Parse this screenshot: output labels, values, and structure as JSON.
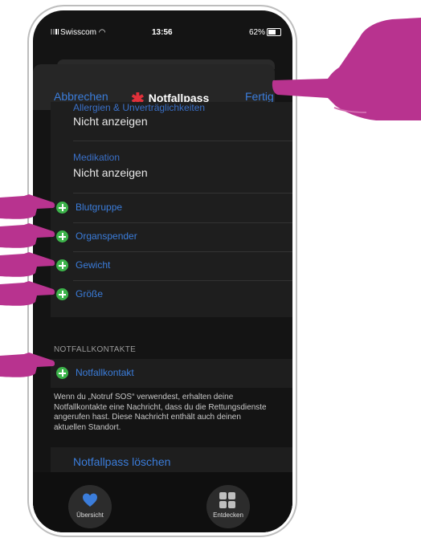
{
  "status_bar": {
    "carrier": "Swisscom",
    "time": "13:56",
    "battery": "62%"
  },
  "nav": {
    "cancel": "Abbrechen",
    "title": "Notfallpass",
    "done": "Fertig"
  },
  "fields": [
    {
      "label": "Allergien & Unverträglichkeiten",
      "value": "Nicht anzeigen"
    },
    {
      "label": "Medikation",
      "value": "Nicht anzeigen"
    }
  ],
  "add_rows": [
    {
      "label": "Blutgruppe"
    },
    {
      "label": "Organspender"
    },
    {
      "label": "Gewicht"
    },
    {
      "label": "Größe"
    }
  ],
  "contacts": {
    "header": "NOTFALLKONTAKTE",
    "add_label": "Notfallkontakt",
    "footer": "Wenn du „Notruf SOS“ verwendest, erhalten deine Notfallkontakte eine Nachricht, dass du die Rettungsdienste angerufen hast. Diese Nachricht enthält auch deinen aktuellen Standort."
  },
  "delete_label": "Notfallpass löschen",
  "tabs": [
    {
      "label": "Übersicht",
      "icon": "heart-icon"
    },
    {
      "label": "Entdecken",
      "icon": "grid-icon"
    }
  ],
  "colors": {
    "accent_blue": "#3b7ddb",
    "add_green": "#3cb34a",
    "star_red": "#e0303a",
    "hand_magenta": "#b8338f"
  }
}
